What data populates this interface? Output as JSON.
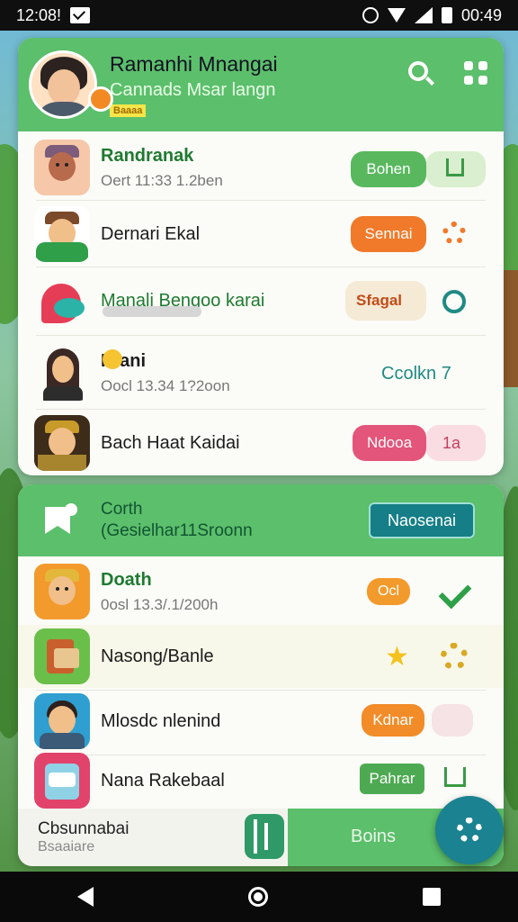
{
  "status": {
    "time": "12:08!",
    "right_text": "00:49"
  },
  "header": {
    "title": "Ramanhi Mnangai",
    "subtitle": "Cannads Msar langn",
    "tag": "Baaaa"
  },
  "list1": [
    {
      "title": "Randranak",
      "sub": "Oert 11:33 1.2ben",
      "action": "Bohen"
    },
    {
      "title": "Dernari Ekal",
      "sub": "",
      "action": "Sennai"
    },
    {
      "title": "Manali Bengoo karai",
      "sub": "",
      "action": "Sfagal"
    },
    {
      "title": "Prani",
      "sub": "Oocl 13.34 1?2oon",
      "action": "Ccolkn 7"
    },
    {
      "title": "Bach Haat Kaidai",
      "sub": "",
      "action": "Ndooa",
      "action2": "1a"
    }
  ],
  "section2": {
    "title": "Corth",
    "subtitle": "(Gesielhar11Sroonn",
    "button": "Naosenai"
  },
  "list2": [
    {
      "title": "Doath",
      "sub": "0osl 13.3/.1/200h",
      "action": "Ocl"
    },
    {
      "title": "Nasong/Banle"
    },
    {
      "title": "Mlosdc nlenind",
      "action": "Kdnar"
    },
    {
      "title": "Nana Rakebaal",
      "action": "Pahrar"
    }
  ],
  "bottom": {
    "title": "Cbsunnabai",
    "subtitle": "Bsaaiare",
    "green_label": "Boins"
  },
  "colors": {
    "primary_green": "#5cbf6b",
    "teal": "#1a8291",
    "orange": "#f07a2a",
    "pink": "#e3557a"
  }
}
